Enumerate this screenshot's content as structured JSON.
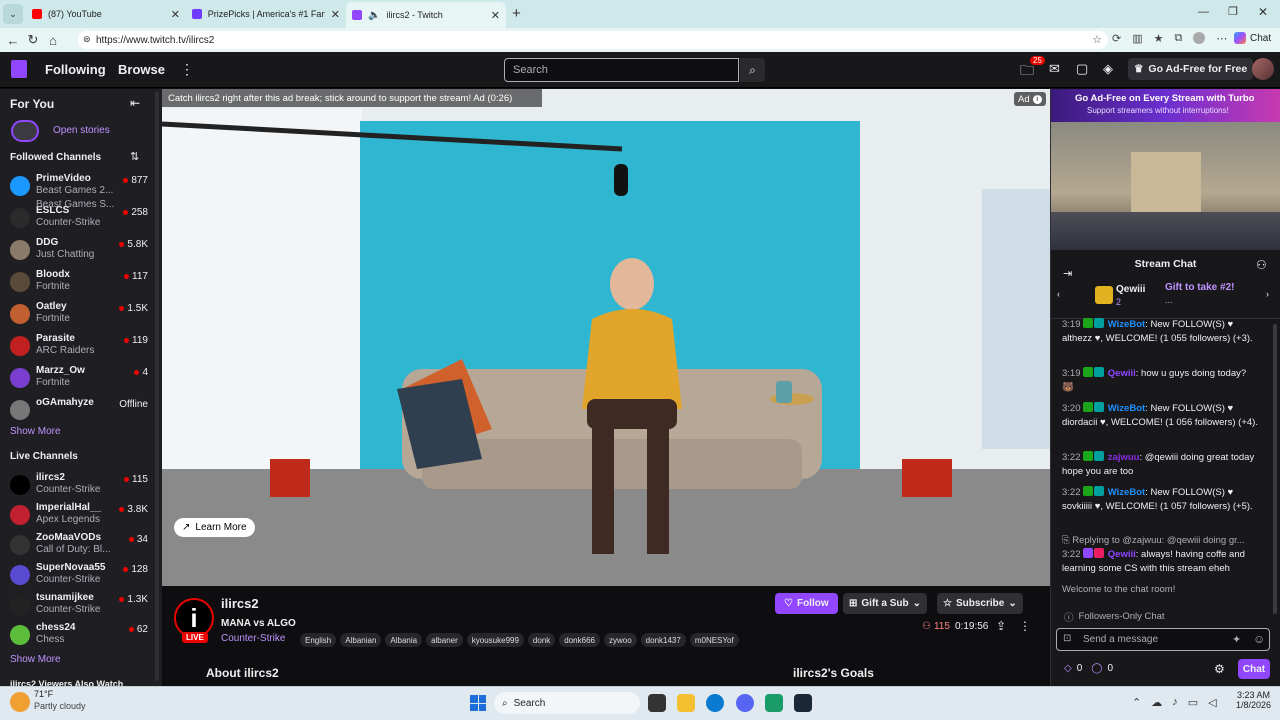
{
  "browser": {
    "tabs": [
      {
        "title": "(87) YouTube",
        "color": "#ff0000"
      },
      {
        "title": "PrizePicks | America's #1 Fantasy S",
        "color": "#6f3cff"
      },
      {
        "title": "ilircs2 - Twitch",
        "color": "#9146ff"
      }
    ],
    "url": "https://www.twitch.tv/ilircs2",
    "copilot_label": "Chat"
  },
  "topnav": {
    "following": "Following",
    "browse": "Browse",
    "search_placeholder": "Search",
    "notif_count": "25",
    "ad_free": "Go Ad-Free for Free"
  },
  "sidebar": {
    "for_you": "For You",
    "open_stories": "Open stories",
    "followed_header": "Followed Channels",
    "followed": [
      {
        "name": "PrimeVideo",
        "game": "Beast Games 2...",
        "game2": "Beast Games S...",
        "viewers": "877",
        "color": "#1a98ff"
      },
      {
        "name": "ESLCS",
        "game": "Counter-Strike",
        "viewers": "258",
        "color": "#2b2b2b"
      },
      {
        "name": "DDG",
        "game": "Just Chatting",
        "viewers": "5.8K",
        "color": "#8a7a6a"
      },
      {
        "name": "Bloodx",
        "game": "Fortnite",
        "viewers": "117",
        "color": "#5a4a3a"
      },
      {
        "name": "Oatley",
        "game": "Fortnite",
        "viewers": "1.5K",
        "color": "#c06030"
      },
      {
        "name": "Parasite",
        "game": "ARC Raiders",
        "viewers": "119",
        "color": "#c02020"
      },
      {
        "name": "Marzz_Ow",
        "game": "Fortnite",
        "viewers": "4",
        "color": "#7a3fd0"
      },
      {
        "name": "oGAmahyze",
        "game": "",
        "viewers": "Offline",
        "color": "#777777"
      }
    ],
    "show_more_1": "Show More",
    "live_header": "Live Channels",
    "live": [
      {
        "name": "ilircs2",
        "game": "Counter-Strike",
        "viewers": "115",
        "color": "#000000"
      },
      {
        "name": "ImperialHal__",
        "game": "Apex Legends",
        "viewers": "3.8K",
        "color": "#c02030"
      },
      {
        "name": "ZooMaaVODs",
        "game": "Call of Duty: Bl...",
        "viewers": "34",
        "color": "#333333"
      },
      {
        "name": "SuperNovaa55",
        "game": "Counter-Strike",
        "viewers": "128",
        "color": "#5a4ad0"
      },
      {
        "name": "tsunamijkee",
        "game": "Counter-Strike",
        "viewers": "1.3K",
        "color": "#222222"
      },
      {
        "name": "chess24",
        "game": "Chess",
        "viewers": "62",
        "color": "#5bbd3a"
      }
    ],
    "show_more_2": "Show More",
    "viewers_also_watch": "ilircs2 Viewers Also Watch"
  },
  "video": {
    "ad_banner": "Catch ilircs2 right after this ad break; stick around to support the stream! Ad (0:26)",
    "ad_label": "Ad",
    "learn_more": "Learn More"
  },
  "stream": {
    "channel": "ilircs2",
    "title": "MANA vs ALGO",
    "category": "Counter-Strike",
    "live": "LIVE",
    "tags": [
      "English",
      "Albanian",
      "Albania",
      "albaner",
      "kyousuke999",
      "donk",
      "donk666",
      "zywoo",
      "donk1437",
      "m0NESYof"
    ],
    "follow": "Follow",
    "gift": "Gift a Sub",
    "subscribe": "Subscribe",
    "viewers": "115",
    "uptime": "0:19:56",
    "about": "About ilircs2",
    "goals": "ilircs2's Goals"
  },
  "ad_panel": {
    "title": "Go Ad-Free on Every Stream with Turbo",
    "subtitle": "Support streamers without interruptions!"
  },
  "chat": {
    "header": "Stream Chat",
    "pinned_user": "Qewiii",
    "pinned_count": "2",
    "pinned_text": "Gift to take #2!",
    "pinned_more": "...",
    "messages": [
      {
        "time": "3:19",
        "user": "WizeBot",
        "user_color": "#1e90ff",
        "text": "New FOLLOW(S) ♥ althezz ♥, WELCOME! (1 055 followers) (+3)."
      },
      {
        "time": "3:19",
        "user": "Qewiii",
        "user_color": "#9146ff",
        "text": "how u guys doing today? 🐻"
      },
      {
        "time": "3:20",
        "user": "WizeBot",
        "user_color": "#1e90ff",
        "text": "New FOLLOW(S) ♥ diordacii ♥, WELCOME! (1 056 followers) (+4)."
      },
      {
        "time": "3:22",
        "user": "zajwuu",
        "user_color": "#8a2be2",
        "text": "@qewiii doing great today hope you are too"
      },
      {
        "time": "3:22",
        "user": "WizeBot",
        "user_color": "#1e90ff",
        "text": "New FOLLOW(S) ♥ sovkiiiii ♥, WELCOME! (1 057 followers) (+5)."
      }
    ],
    "reply_to": "Replying to @zajwuu: @qewiii doing gr...",
    "reply_time": "3:22",
    "reply_user": "Qewiii",
    "reply_text": "always! having coffe and learning some CS with this stream eheh",
    "welcome": "Welcome to the chat room!",
    "followers_only": "Followers-Only Chat",
    "input_placeholder": "Send a message",
    "bits": "0",
    "points": "0",
    "chat_button": "Chat"
  },
  "taskbar": {
    "weather_temp": "71°F",
    "weather_desc": "Partly cloudy",
    "search": "Search",
    "time": "3:23 AM",
    "date": "1/8/2026"
  }
}
